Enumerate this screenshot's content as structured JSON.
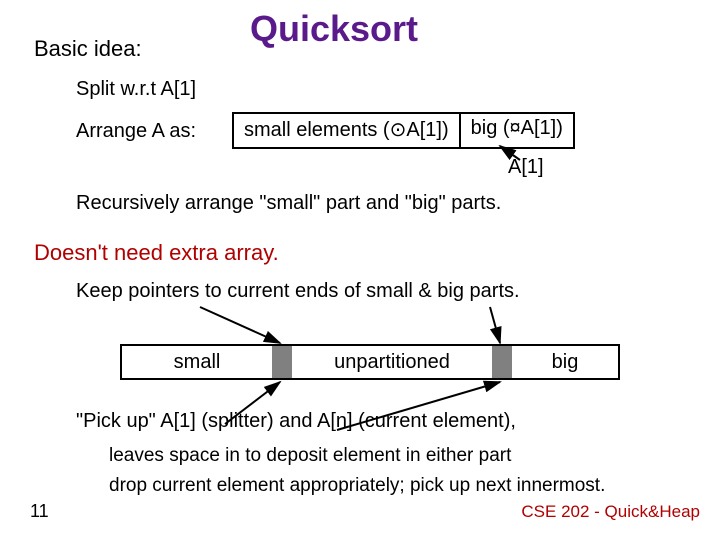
{
  "title": "Quicksort",
  "basic_idea": "Basic idea:",
  "split": "Split w.r.t A[1]",
  "arrange_label": "Arrange A as:",
  "arrange_left_pre": "small elements (",
  "arrange_left_sym": "⊙",
  "arrange_left_post": "A[1])",
  "arrange_right_pre": "big (",
  "arrange_right_sym": "¤",
  "arrange_right_post": "A[1])",
  "a1_label": "A[1]",
  "recursive": "Recursively arrange \"small\" part and \"big\" parts.",
  "noextra": "Doesn't need extra array.",
  "keep_pointers": "Keep pointers to current ends of small & big parts.",
  "seg_small": "small",
  "seg_unpart": "unpartitioned",
  "seg_big": "big",
  "pickup": "\"Pick up\" A[1] (splitter) and A[n] (current element),",
  "leaves": "leaves space in to deposit element in either part",
  "drop": "drop current element appropriately; pick up next innermost.",
  "pagenum": "11",
  "footer": "CSE 202 - Quick&Heap"
}
